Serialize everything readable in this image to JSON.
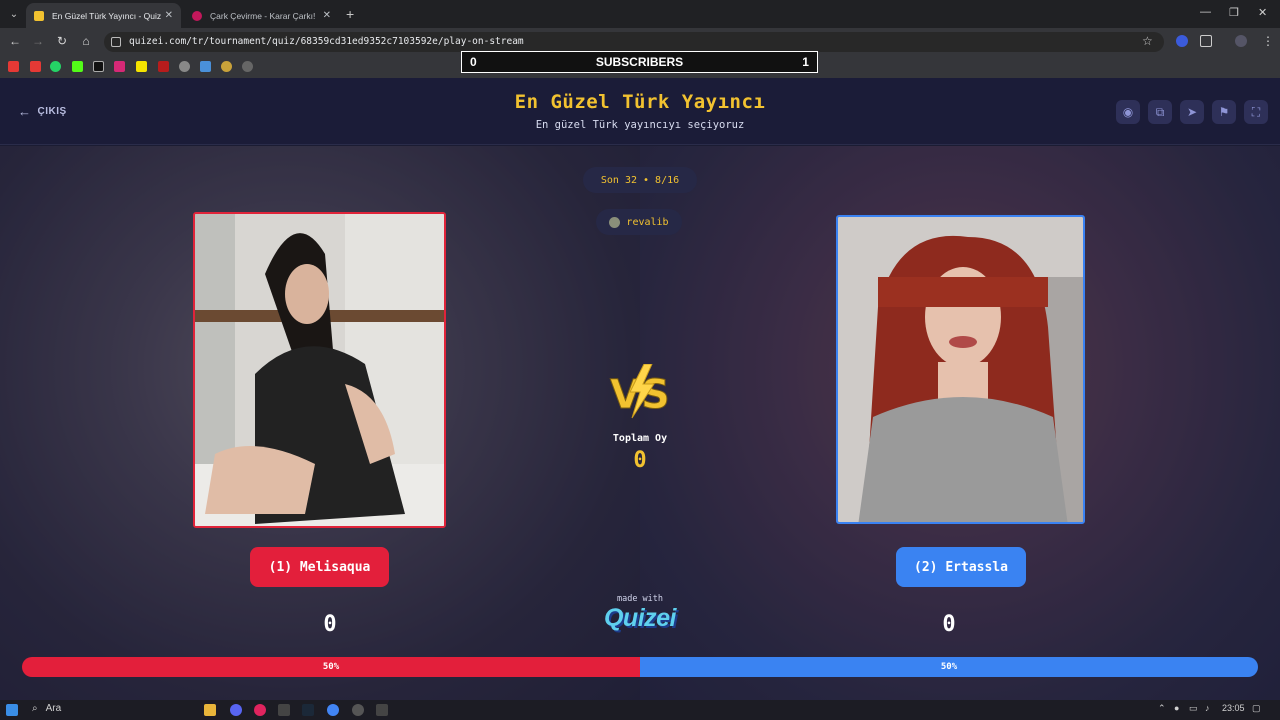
{
  "browser": {
    "tabs": [
      {
        "title": "En Güzel Türk Yayıncı - Quizei",
        "active": true,
        "favicon_color": "#f2c230"
      },
      {
        "title": "Çark Çevirme - Karar Çarkı!",
        "active": false,
        "favicon_color": "#c2185b"
      }
    ],
    "url": "quizei.com/tr/tournament/quiz/68359cd31ed9352c7103592e/play-on-stream"
  },
  "overlay": {
    "subscribers_label": "SUBSCRIBERS",
    "left_count": "0",
    "right_count": "1"
  },
  "header": {
    "exit_label": "ÇIKIŞ",
    "title": "En Güzel Türk Yayıncı",
    "subtitle": "En güzel Türk yayıncıyı seçiyoruz",
    "actions": [
      "eye-icon",
      "copy-icon",
      "send-icon",
      "flag-icon",
      "fullscreen-icon"
    ]
  },
  "round": {
    "label": "Son 32 • 8/16",
    "creator": "revalib"
  },
  "contestants": {
    "left": {
      "label": "(1) Melisaqua",
      "score": "0",
      "color": "#e31f3b"
    },
    "right": {
      "label": "(2) Ertassla",
      "score": "0",
      "color": "#3a83f2"
    }
  },
  "vote": {
    "total_label": "Toplam Oy",
    "total": "0",
    "left_percent": "50%",
    "right_percent": "50%",
    "left_fraction": 0.5
  },
  "footer": {
    "made_with": "made with",
    "brand": "Quizei"
  },
  "taskbar": {
    "search_label": "Ara",
    "time": "23:05"
  }
}
